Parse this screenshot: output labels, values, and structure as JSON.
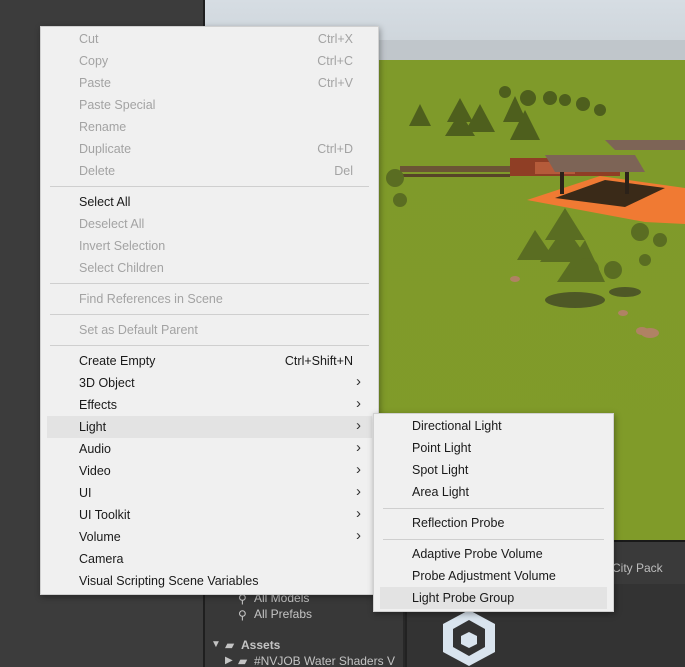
{
  "context_menu": {
    "items": [
      {
        "label": "Cut",
        "shortcut": "Ctrl+X",
        "disabled": true
      },
      {
        "label": "Copy",
        "shortcut": "Ctrl+C",
        "disabled": true
      },
      {
        "label": "Paste",
        "shortcut": "Ctrl+V",
        "disabled": true
      },
      {
        "label": "Paste Special",
        "disabled": true
      },
      {
        "label": "Rename",
        "disabled": true
      },
      {
        "label": "Duplicate",
        "shortcut": "Ctrl+D",
        "disabled": true
      },
      {
        "label": "Delete",
        "shortcut": "Del",
        "disabled": true
      },
      {
        "label": "Select All",
        "disabled": false
      },
      {
        "label": "Deselect All",
        "disabled": true
      },
      {
        "label": "Invert Selection",
        "disabled": true
      },
      {
        "label": "Select Children",
        "disabled": true
      },
      {
        "label": "Find References in Scene",
        "disabled": true
      },
      {
        "label": "Set as Default Parent",
        "disabled": true
      },
      {
        "label": "Create Empty",
        "shortcut": "Ctrl+Shift+N",
        "disabled": false
      },
      {
        "label": "3D Object",
        "submenu": true
      },
      {
        "label": "Effects",
        "submenu": true
      },
      {
        "label": "Light",
        "submenu": true,
        "highlighted": true
      },
      {
        "label": "Audio",
        "submenu": true
      },
      {
        "label": "Video",
        "submenu": true
      },
      {
        "label": "UI",
        "submenu": true
      },
      {
        "label": "UI Toolkit",
        "submenu": true
      },
      {
        "label": "Volume",
        "submenu": true
      },
      {
        "label": "Camera"
      },
      {
        "label": "Visual Scripting Scene Variables"
      }
    ],
    "arrow_glyph": "›"
  },
  "light_submenu": {
    "items": [
      {
        "label": "Directional Light"
      },
      {
        "label": "Point Light"
      },
      {
        "label": "Spot Light"
      },
      {
        "label": "Area Light"
      },
      {
        "label": "Reflection Probe"
      },
      {
        "label": "Adaptive Probe Volume"
      },
      {
        "label": "Probe Adjustment Volume"
      },
      {
        "label": "Light Probe Group",
        "highlighted": true
      }
    ]
  },
  "project_panel": {
    "favorites": [
      "All Models",
      "All Prefabs"
    ],
    "assets_label": "Assets",
    "first_folder": "#NVJOB Water Shaders V",
    "breadcrumb_tail": "City Pack"
  },
  "colors": {
    "menu_bg": "#f0f0f0",
    "highlight": "#e3e3e3",
    "disabled_text": "#a3a3a3",
    "ground": "#809b29"
  }
}
